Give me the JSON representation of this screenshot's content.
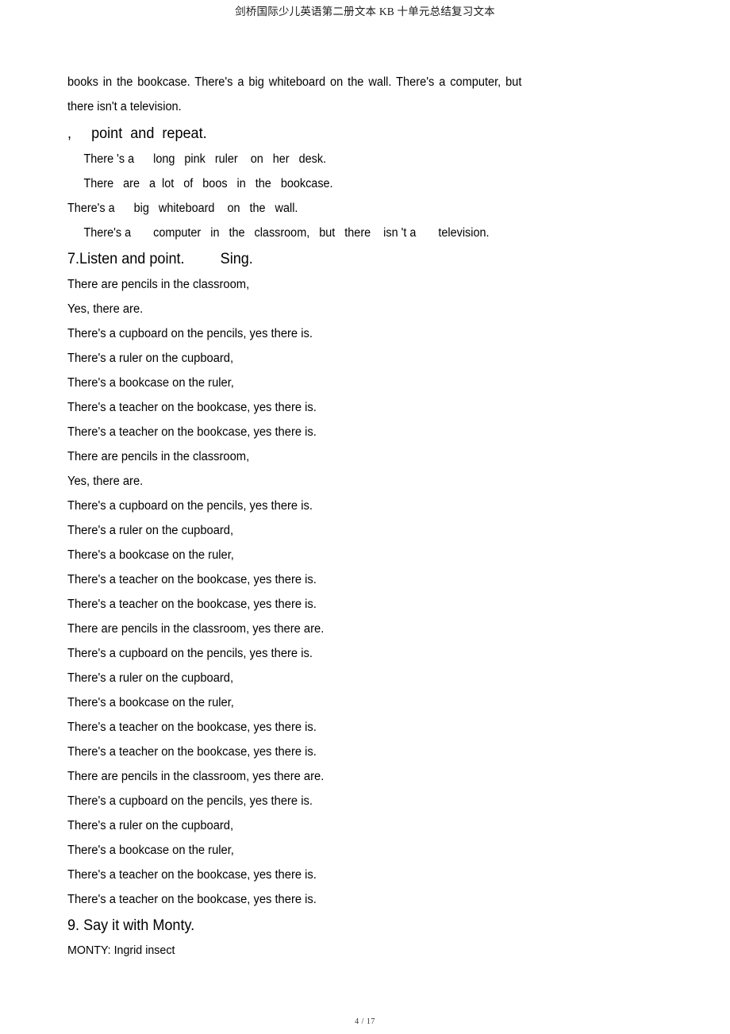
{
  "header": {
    "title": "剑桥国际少儿英语第二册文本 KB 十单元总结复习文本"
  },
  "footer": {
    "page_label": "4 / 17"
  },
  "content": {
    "paragraph_1": {
      "line_1": "books in  the bookcase.  There's     a big  whiteboard   on the wall.    There's  a computer,  but",
      "line_2": "there isn't a television."
    },
    "listen_instruction": ",     point  and  repeat.",
    "repeat_lines": [
      "There 's a      long   pink   ruler    on   her   desk.",
      "There   are   a  lot   of   boos   in   the   bookcase.",
      "There's a      big   whiteboard    on   the   wall.",
      "There's a       computer   in   the   classroom,   but   there    isn 't a       television."
    ],
    "heading_7": "7.Listen and point.         Sing.",
    "song_lines": [
      "There are pencils in the classroom,",
      "Yes, there are.",
      "There's a cupboard on the pencils, yes there is.",
      "There's a ruler on the cupboard,",
      "There's a bookcase on the ruler,",
      "There's a teacher on the bookcase, yes there is.",
      "There's a teacher on the bookcase, yes there is.",
      "There are pencils in the classroom,",
      "Yes, there are.",
      "There's a cupboard on the pencils, yes there is.",
      "There's a ruler on the cupboard,",
      "There's a bookcase on the ruler,",
      "There's a teacher on the bookcase, yes there is.",
      "There's a teacher on the bookcase, yes there is.",
      "There are pencils in the classroom, yes there are.",
      "There's a cupboard on the pencils, yes there is.",
      "There's a ruler on the cupboard,",
      "There's a bookcase on the ruler,",
      "There's a teacher on the bookcase, yes there is.",
      "There's a teacher on the bookcase, yes there is.",
      "There are pencils in the classroom, yes there are.",
      "There's a cupboard on the pencils, yes there is.",
      "There's a ruler on the cupboard,",
      "There's a bookcase on the ruler,",
      "There's a teacher on the bookcase, yes there is.",
      "There's a teacher on the bookcase, yes there is."
    ],
    "heading_9": "9. Say it with Monty.",
    "monty_line": "MONTY: Ingrid insect"
  }
}
